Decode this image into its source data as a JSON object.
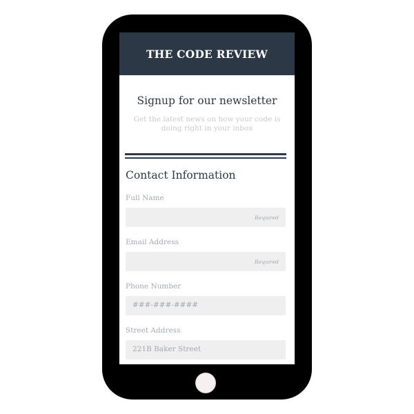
{
  "app": {
    "title": "THE CODE REVIEW"
  },
  "newsletter": {
    "heading": "Signup for our newsletter",
    "description": "Get the latest news on how your code is doing right in your inbox"
  },
  "contact": {
    "section_title": "Contact Information",
    "fields": {
      "full_name": {
        "label": "Full Name",
        "hint": "Required",
        "value": ""
      },
      "email": {
        "label": "Email Address",
        "hint": "Required",
        "value": ""
      },
      "phone": {
        "label": "Phone Number",
        "placeholder": "###-###-####",
        "value": ""
      },
      "street": {
        "label": "Street Address",
        "placeholder": "221B Baker Street",
        "value": ""
      }
    }
  },
  "colors": {
    "header_bg": "#2c3845",
    "field_bg": "#efefef",
    "muted_text": "#a3a9b1",
    "phone_frame": "#000000"
  },
  "icons": {
    "home_button": "home-button-icon"
  }
}
